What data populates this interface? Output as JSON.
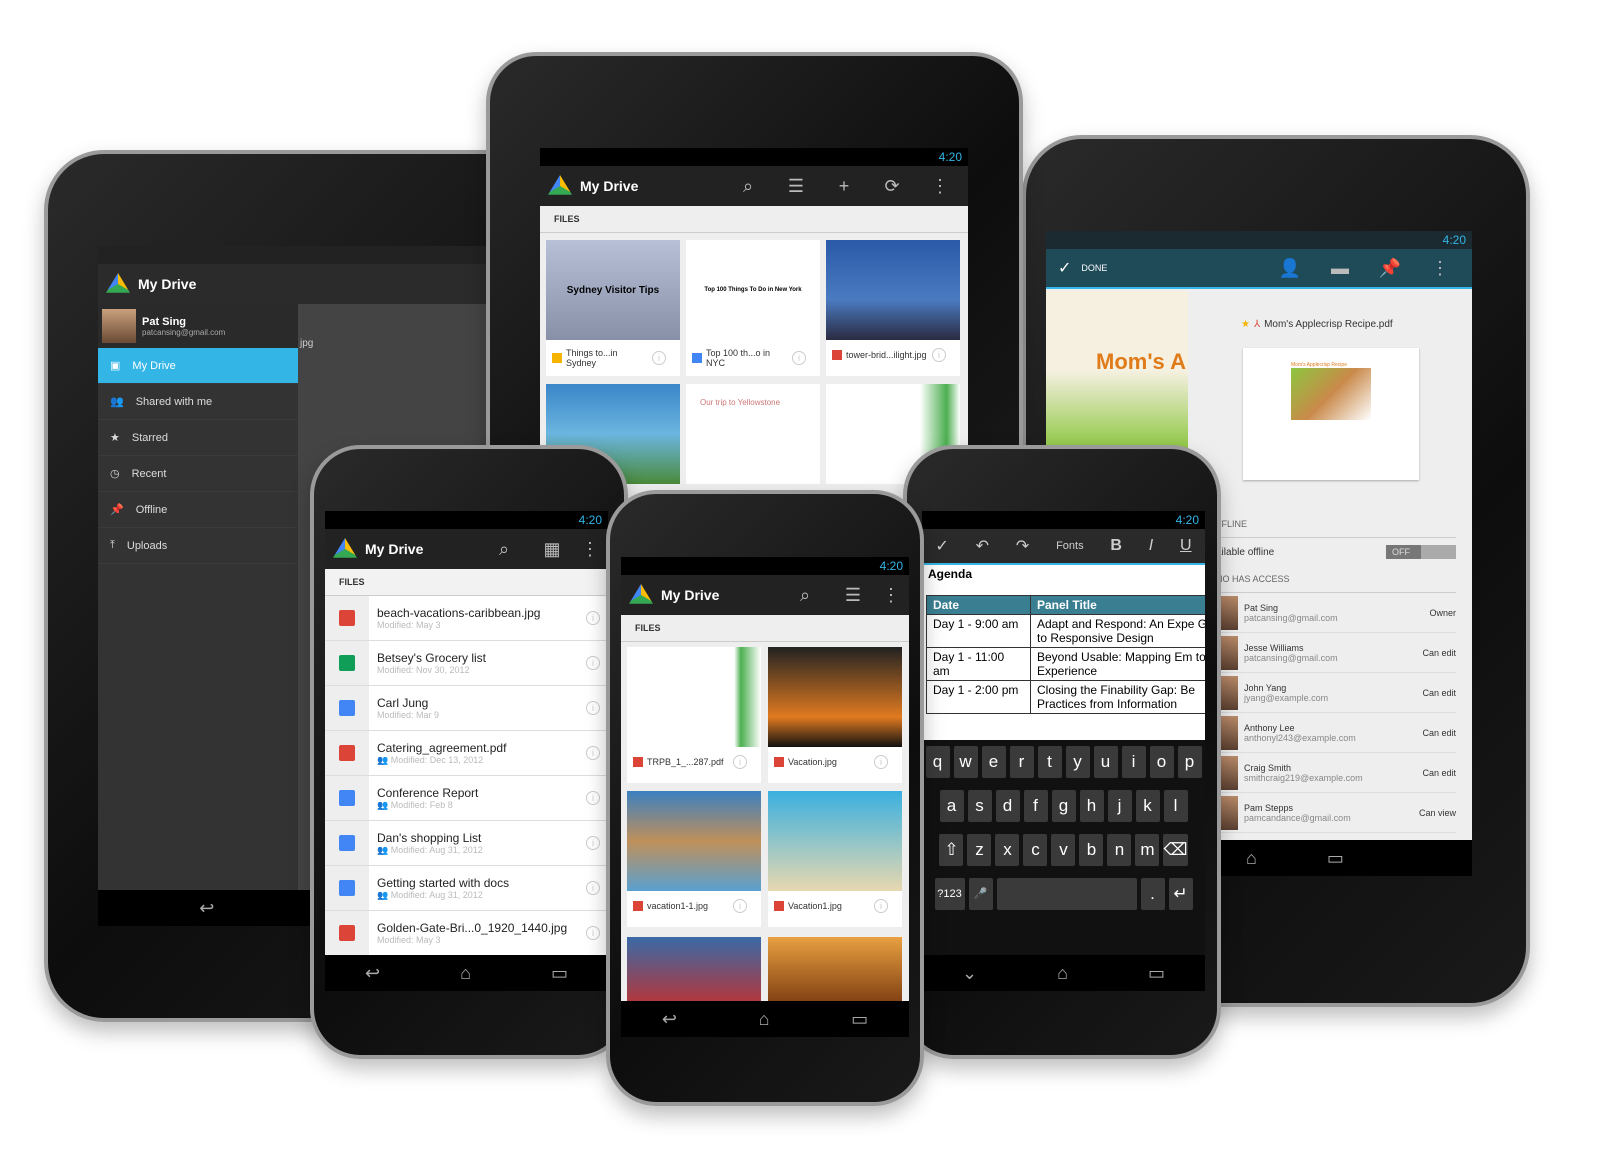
{
  "status_time": "4:20",
  "app_title": "My Drive",
  "files_section": "FILES",
  "left_tablet": {
    "user_name": "Pat Sing",
    "user_email": "patcansing@gmail.com",
    "nav": [
      {
        "label": "My Drive",
        "icon": "drive-icon",
        "selected": true
      },
      {
        "label": "Shared with me",
        "icon": "people-icon"
      },
      {
        "label": "Starred",
        "icon": "star-icon"
      },
      {
        "label": "Recent",
        "icon": "clock-icon"
      },
      {
        "label": "Offline",
        "icon": "pin-icon"
      },
      {
        "label": "Uploads",
        "icon": "upload-icon"
      }
    ],
    "peek_text": "jpg"
  },
  "top_tablet": {
    "tiles": [
      {
        "name": "Things to...in Sydney",
        "thumb_text": "Sydney Visitor Tips",
        "type": "slides",
        "color": "#f4b400"
      },
      {
        "name": "Top 100 th...o in NYC",
        "thumb_text": "Top 100 Things To Do in New York",
        "type": "doc",
        "color": "#4285f4"
      },
      {
        "name": "tower-brid...ilight.jpg",
        "type": "image",
        "color": "#db4437"
      }
    ],
    "second_row_text": "Our trip to Yellowstone"
  },
  "right_tablet": {
    "done_label": "DONE",
    "file_name": "Mom's Applecrisp Recipe.pdf",
    "preview_title": "Mom's Applecrisp Recipe",
    "bg_title": "Mom's A",
    "offline_section": "FFLINE",
    "offline_label": "ailable offline",
    "offline_toggle": "OFF",
    "access_section": "HO HAS ACCESS",
    "people": [
      {
        "name": "Pat Sing",
        "email": "patcansing@gmail.com",
        "role": "Owner"
      },
      {
        "name": "Jesse Williams",
        "email": "patcansing@gmail.com",
        "role": "Can edit"
      },
      {
        "name": "John Yang",
        "email": "jyang@example.com",
        "role": "Can edit"
      },
      {
        "name": "Anthony Lee",
        "email": "anthonyl243@example.com",
        "role": "Can edit"
      },
      {
        "name": "Craig Smith",
        "email": "smithcraig219@example.com",
        "role": "Can edit"
      },
      {
        "name": "Pam Stepps",
        "email": "pamcandance@gmail.com",
        "role": "Can view"
      }
    ]
  },
  "left_phone": {
    "files": [
      {
        "name": "beach-vacations-caribbean.jpg",
        "modified": "Modified: May 3",
        "type": "image",
        "color": "#db4437"
      },
      {
        "name": "Betsey's Grocery list",
        "modified": "Modified: Nov 30, 2012",
        "type": "sheet",
        "color": "#0f9d58"
      },
      {
        "name": "Carl Jung",
        "modified": "Modified: Mar 9",
        "type": "doc",
        "color": "#4285f4"
      },
      {
        "name": "Catering_agreement.pdf",
        "modified": "Modified: Dec 13, 2012",
        "type": "pdf",
        "color": "#db4437",
        "shared": true
      },
      {
        "name": "Conference Report",
        "modified": "Modified: Feb 8",
        "type": "doc",
        "color": "#4285f4",
        "shared": true
      },
      {
        "name": "Dan's shopping List",
        "modified": "Modified: Aug 31, 2012",
        "type": "doc",
        "color": "#4285f4",
        "shared": true
      },
      {
        "name": "Getting started with docs",
        "modified": "Modified: Aug 31, 2012",
        "type": "doc",
        "color": "#4285f4",
        "shared": true
      },
      {
        "name": "Golden-Gate-Bri...0_1920_1440.jpg",
        "modified": "Modified: May 3",
        "type": "image",
        "color": "#db4437"
      }
    ]
  },
  "center_phone": {
    "tiles": [
      {
        "name": "TRPB_1_...287.pdf",
        "type": "pdf"
      },
      {
        "name": "Vacation.jpg",
        "type": "image"
      },
      {
        "name": "vacation1-1.jpg",
        "type": "image"
      },
      {
        "name": "Vacation1.jpg",
        "type": "image"
      }
    ]
  },
  "right_phone": {
    "fonts_label": "Fonts",
    "bold": "B",
    "italic": "I",
    "underline": "U",
    "heading": "Agenda",
    "table_headers": [
      "Date",
      "Panel Title"
    ],
    "table_rows": [
      [
        "Day 1 - 9:00 am",
        "Adapt and Respond: An Expe Guide to Responsive Design"
      ],
      [
        "Day 1 - 11:00 am",
        "Beyond Usable: Mapping Em to Experience"
      ],
      [
        "Day 1 - 2:00 pm",
        "Closing the Finability Gap: Be Practices from Information"
      ]
    ],
    "keys": [
      [
        "q",
        "w",
        "e",
        "r",
        "t",
        "y",
        "u",
        "i",
        "o",
        "p"
      ],
      [
        "a",
        "s",
        "d",
        "f",
        "g",
        "h",
        "j",
        "k",
        "l"
      ],
      [
        "⇧",
        "z",
        "x",
        "c",
        "v",
        "b",
        "n",
        "m",
        "⌫"
      ],
      [
        "?123",
        "🎤",
        "␣",
        ".",
        "↵"
      ]
    ]
  }
}
